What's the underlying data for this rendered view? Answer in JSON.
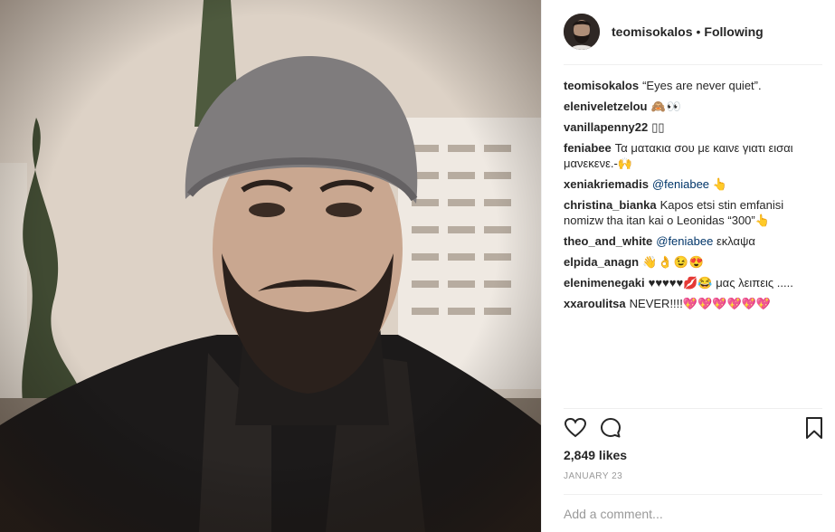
{
  "header": {
    "username": "teomisokalos",
    "separator": "•",
    "follow_status": "Following"
  },
  "comments": [
    {
      "user": "teomisokalos",
      "text": "“Eyes are never quiet”."
    },
    {
      "user": "eleniveletzelou",
      "text": "🙈👀"
    },
    {
      "user": "vanillapenny22",
      "text": "▯▯"
    },
    {
      "user": "feniabee",
      "text": "Τα ματακια σου με καινε γιατι εισαι μανεκενε.-🙌"
    },
    {
      "user": "xeniakriemadis",
      "mention": "@feniabee",
      "text": "👆"
    },
    {
      "user": "christina_bianka",
      "text": "Kapos etsi stin emfanisi nomizw tha itan kai o Leonidas “300”👆"
    },
    {
      "user": "theo_and_white",
      "mention": "@feniabee",
      "text": "εκλαψα"
    },
    {
      "user": "elpida_anagn",
      "text": "👋👌😉😍"
    },
    {
      "user": "elenimenegaki",
      "text": "♥♥♥♥♥💋😂 μας λειπεις ....."
    },
    {
      "user": "xxaroulitsa",
      "text": "NEVER!!!!💖💖💖💖💖💖"
    }
  ],
  "actions": {
    "like_icon": "heart-outline-icon",
    "comment_icon": "comment-bubble-icon",
    "save_icon": "bookmark-icon"
  },
  "likes": "2,849 likes",
  "date": "JANUARY 23",
  "add_comment": {
    "placeholder": "Add a comment..."
  }
}
